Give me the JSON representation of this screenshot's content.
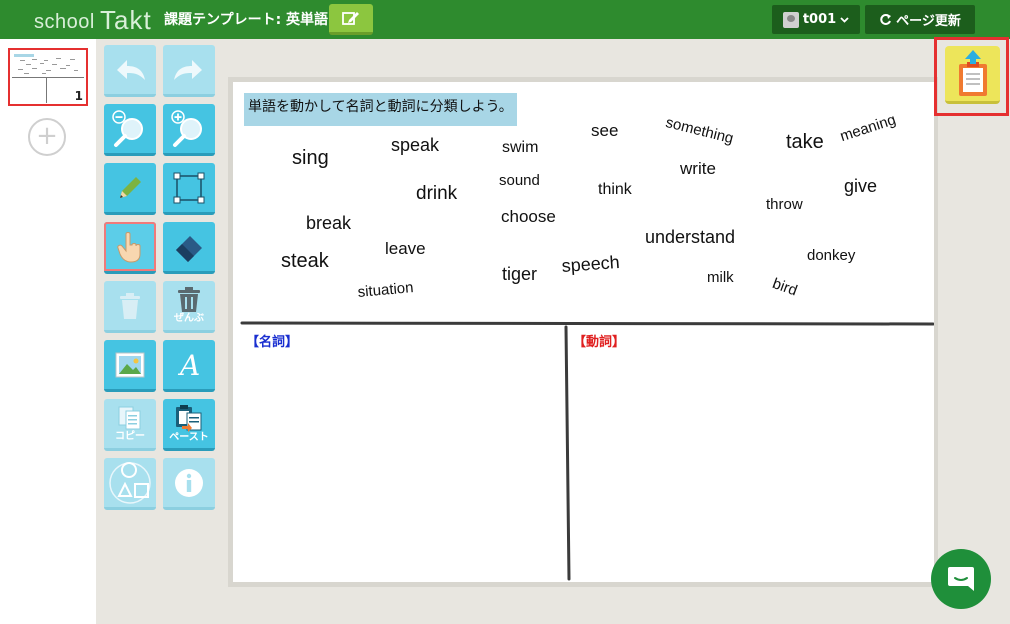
{
  "header": {
    "logo_school": "school",
    "logo_takt": "Takt",
    "task_title": "課題テンプレート: 英単語",
    "user_name": "t001",
    "refresh_label": "ページ更新"
  },
  "pages": {
    "current_page_number": "1",
    "add_label": "+"
  },
  "tools": {
    "delete_all_label": "ぜんぶ",
    "copy_label": "コピー",
    "paste_label": "ペースト"
  },
  "canvas": {
    "instruction": "単語を動かして名詞と動詞に分類しよう。",
    "noun_label": "【名詞】",
    "verb_label": "【動詞】",
    "words": [
      "sing",
      "speak",
      "swim",
      "see",
      "something",
      "take",
      "meaning",
      "sound",
      "write",
      "drink",
      "think",
      "give",
      "throw",
      "break",
      "choose",
      "leave",
      "understand",
      "steak",
      "donkey",
      "speech",
      "tiger",
      "milk",
      "situation",
      "bird"
    ]
  },
  "colors": {
    "header_bg": "#2e8b2e",
    "tool_blue": "#45c4e2",
    "noun_color": "#1a2fd0",
    "verb_color": "#e02020",
    "highlight_red": "#e53030"
  }
}
